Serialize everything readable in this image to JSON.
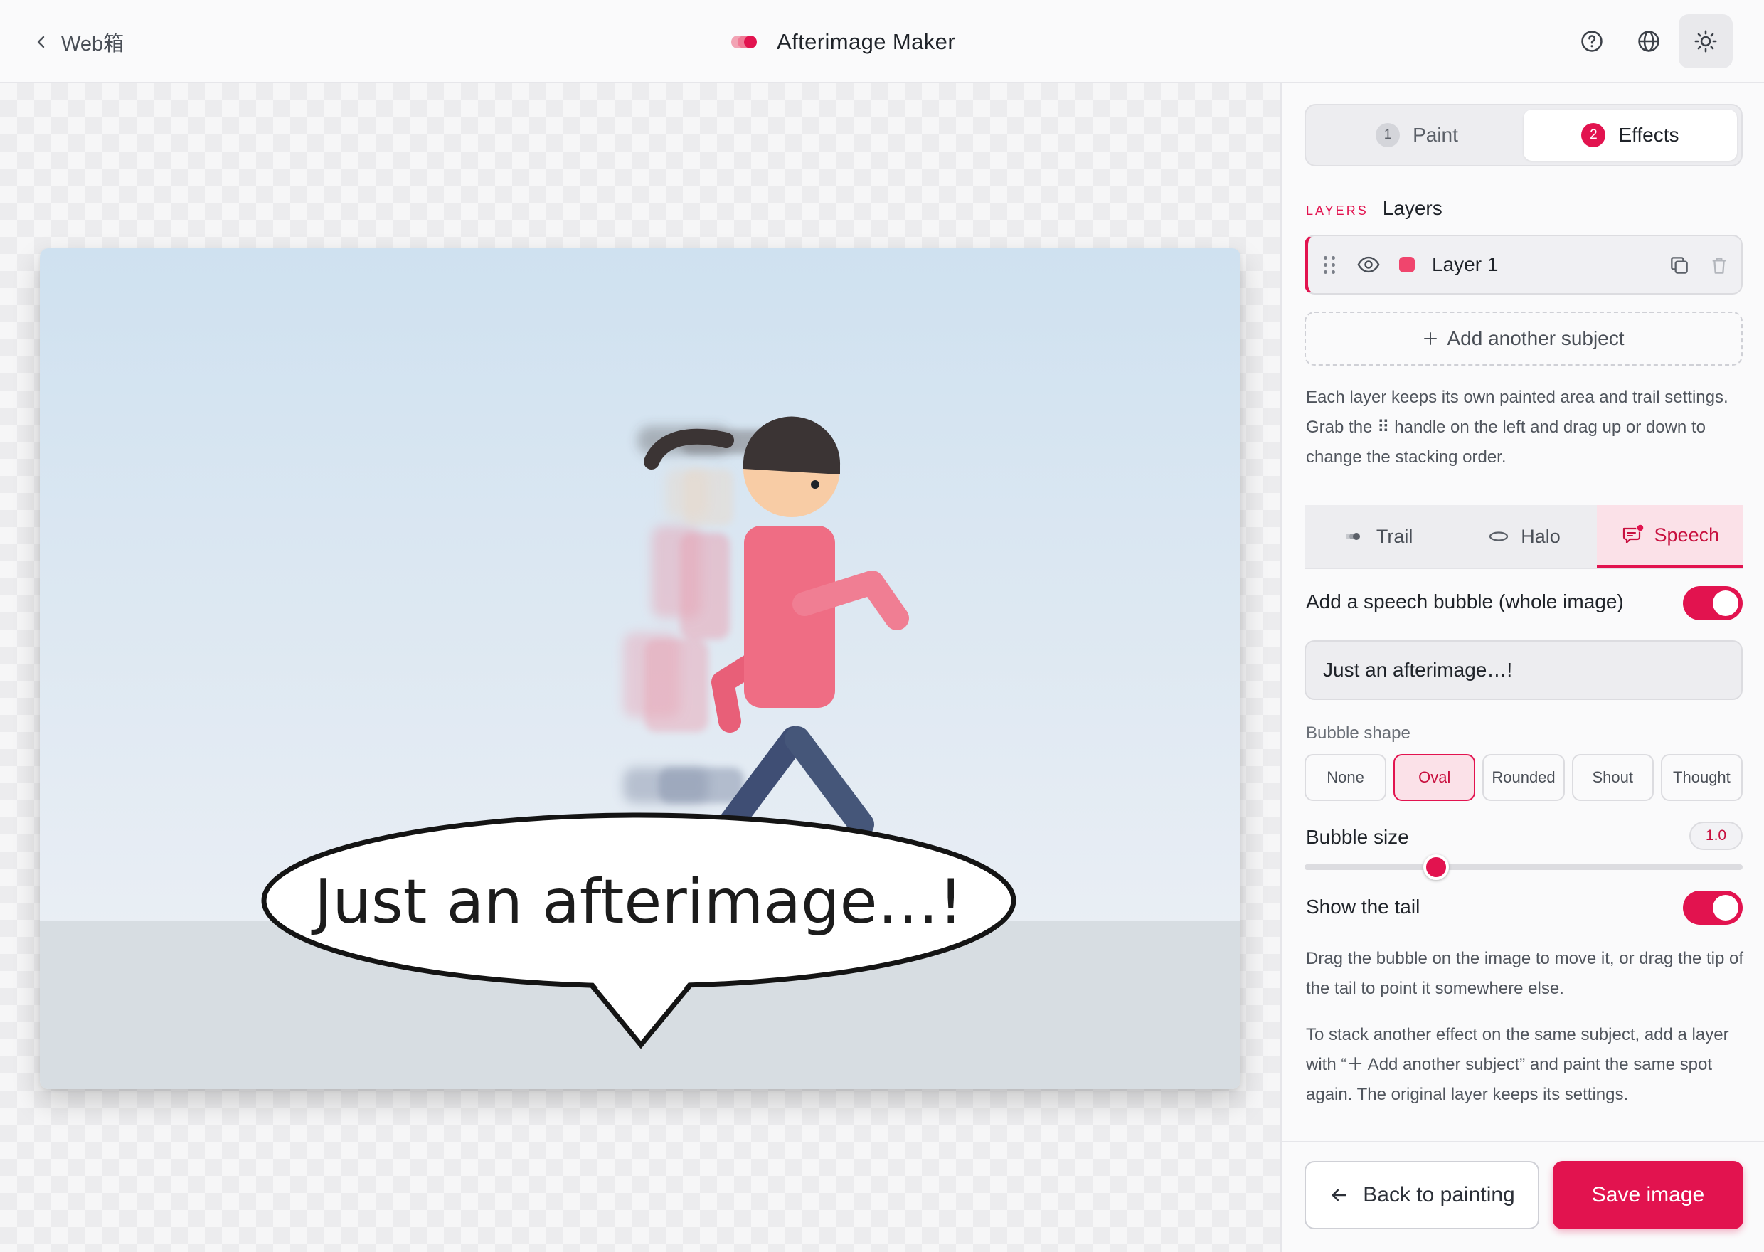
{
  "header": {
    "back_label": "Web箱",
    "app_title": "Afterimage Maker",
    "icons": [
      "help-icon",
      "globe-icon",
      "sun-icon"
    ]
  },
  "canvas": {
    "bubble_text": "Just an afterimage…!"
  },
  "panel": {
    "steps": [
      {
        "num": "1",
        "label": "Paint",
        "active": false
      },
      {
        "num": "2",
        "label": "Effects",
        "active": true
      }
    ],
    "layers": {
      "eyebrow": "LAYERS",
      "title": "Layers",
      "items": [
        {
          "name": "Layer 1",
          "color": "#f0456d"
        }
      ],
      "add_label": "Add another subject",
      "help": "Each layer keeps its own painted area and trail settings. Grab the ⠿ handle on the left and drag up or down to change the stacking order."
    },
    "effect_tabs": [
      {
        "label": "Trail",
        "icon": "trail-icon",
        "active": false
      },
      {
        "label": "Halo",
        "icon": "halo-icon",
        "active": false
      },
      {
        "label": "Speech",
        "icon": "speech-bubble-icon",
        "active": true
      }
    ],
    "speech": {
      "toggle_label": "Add a speech bubble (whole image)",
      "enabled": true,
      "text_value": "Just an afterimage…!",
      "shape_label": "Bubble shape",
      "shapes": [
        "None",
        "Oval",
        "Rounded",
        "Shout",
        "Thought"
      ],
      "selected_shape": "Oval",
      "size_label": "Bubble size",
      "size_value": "1.0",
      "size_fraction": 0.3,
      "tail_label": "Show the tail",
      "tail_enabled": true,
      "help_1": "Drag the bubble on the image to move it, or drag the tip of the tail to point it somewhere else.",
      "help_2": "To stack another effect on the same subject, add a layer with “＋ Add another subject” and paint the same spot again. The original layer keeps its settings."
    },
    "footer": {
      "back_label": "Back to painting",
      "save_label": "Save image"
    }
  },
  "colors": {
    "accent": "#e2134f",
    "accent_soft": "#fbe1e8"
  }
}
